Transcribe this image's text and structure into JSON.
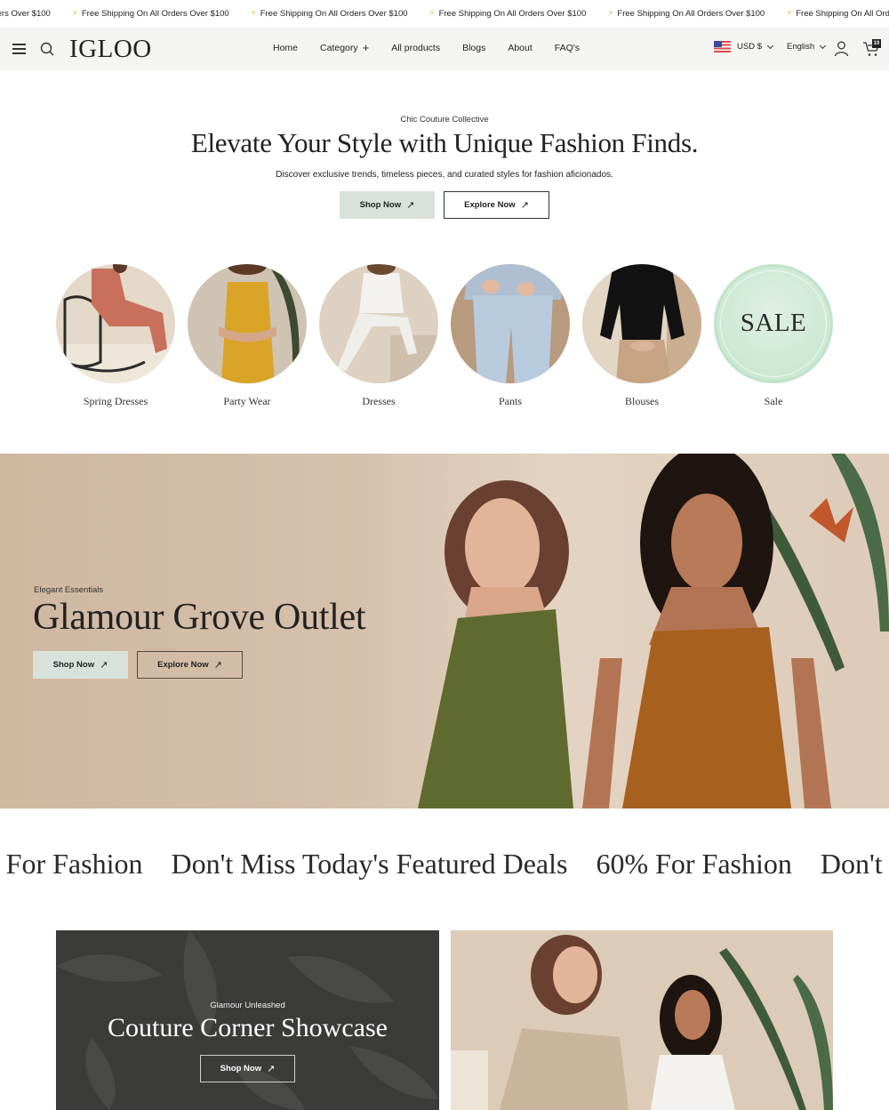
{
  "announcement": {
    "icon": "lightning-bolt-icon",
    "items": [
      "Free Shipping On All Orders Over $100",
      "Free Shipping On All Orders Over $100",
      "Free Shipping On All Orders Over $100",
      "Free Shipping On All Orders Over $100",
      "Free Shipping On All Orders Over $100",
      "Free Shipping On All Orders Over $100"
    ]
  },
  "header": {
    "logo": "IGLOO",
    "nav": [
      {
        "label": "Home"
      },
      {
        "label": "Category"
      },
      {
        "label": "All products"
      },
      {
        "label": "Blogs"
      },
      {
        "label": "About"
      },
      {
        "label": "FAQ's"
      }
    ],
    "currency": "USD $",
    "language": "English",
    "cart_count": "10"
  },
  "hero": {
    "eyebrow": "Chic Couture Collective",
    "title": "Elevate Your Style with Unique Fashion Finds.",
    "subtitle": "Discover exclusive trends, timeless pieces, and curated styles for fashion aficionados.",
    "shop_label": "Shop Now",
    "explore_label": "Explore Now",
    "arrow": "↗"
  },
  "categories": [
    {
      "label": "Spring Dresses"
    },
    {
      "label": "Party Wear"
    },
    {
      "label": "Dresses"
    },
    {
      "label": "Pants"
    },
    {
      "label": "Blouses"
    },
    {
      "label": "Sale",
      "badge": "SALE"
    }
  ],
  "banner": {
    "eyebrow": "Elegant Essentials",
    "title": "Glamour Grove Outlet",
    "shop_label": "Shop Now",
    "explore_label": "Explore Now"
  },
  "marquee": {
    "items": [
      "60% For Fashion",
      "Don't Miss Today's Featured Deals",
      "60% For Fashion",
      "Don't Miss Today's Featured Deals"
    ]
  },
  "promo": {
    "eyebrow": "Glamour Unleashed",
    "title": "Couture Corner Showcase",
    "shop_label": "Shop Now"
  },
  "colors": {
    "header_bg": "#f4f5f2",
    "button_fill": "#d8e2db",
    "sale_green": "#cbe8d3",
    "dark_card": "#3b3c3a",
    "banner_beige": "#d6c0ab"
  }
}
